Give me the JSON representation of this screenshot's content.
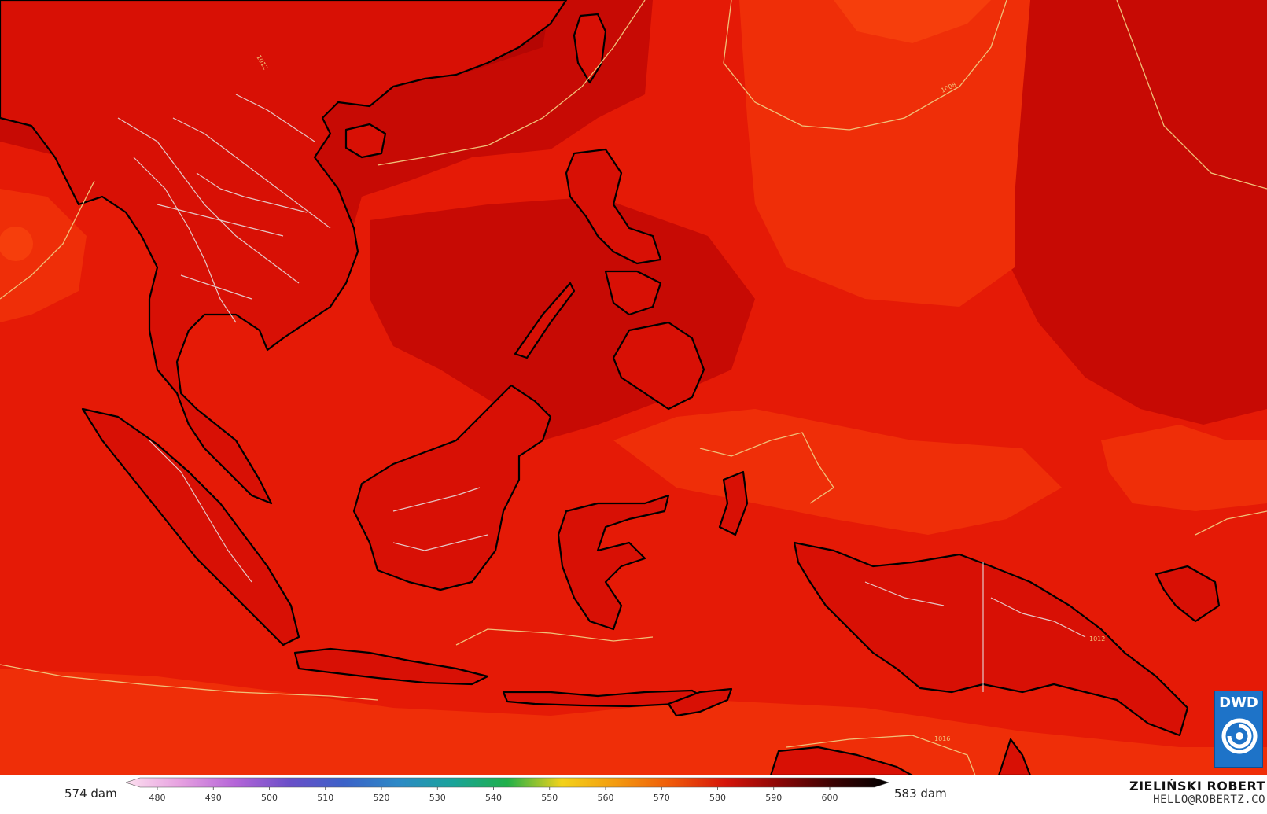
{
  "map": {
    "field_colors": {
      "base": "#e51a06",
      "dark": "#c70a04",
      "darker": "#b50603",
      "light": "#ef2e08",
      "lighter": "#f63e0c"
    },
    "isobar_color": "#f0c078",
    "isobar_labels": [
      "1008",
      "1012",
      "1012",
      "1016"
    ]
  },
  "legend": {
    "min_label": "574 dam",
    "max_label": "583 dam",
    "ticks": [
      "480",
      "490",
      "500",
      "510",
      "520",
      "530",
      "540",
      "550",
      "560",
      "570",
      "580",
      "590",
      "600"
    ],
    "colors": [
      "#fde0ef",
      "#e6a0e0",
      "#b565d8",
      "#6a4fc8",
      "#3c62c8",
      "#2d89c6",
      "#1aa39a",
      "#20b04a",
      "#f3d21a",
      "#f39a10",
      "#ef5a0a",
      "#d6150a",
      "#8a0606",
      "#3a0303",
      "#000000"
    ]
  },
  "credit": {
    "name": "ZIELIŃSKI ROBERT",
    "email": "HELLO@ROBERTZ.CO"
  },
  "logo": {
    "text": "DWD",
    "color": "#1e73c8"
  }
}
